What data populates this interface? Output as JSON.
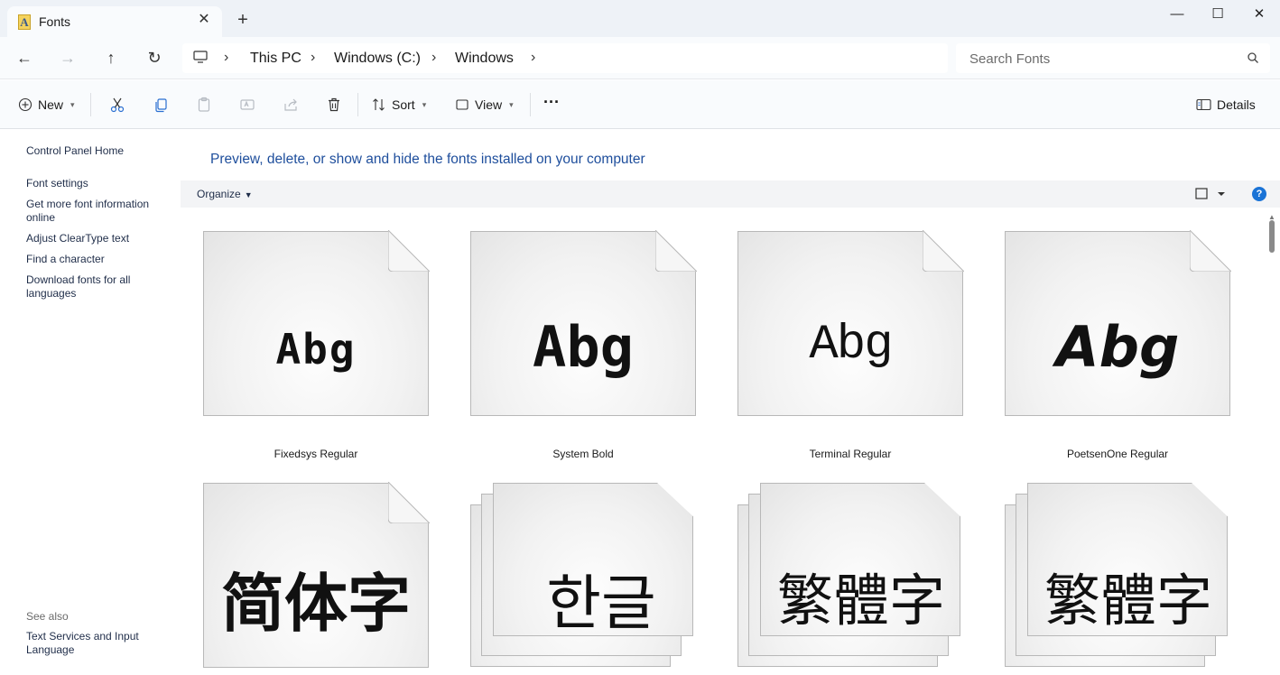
{
  "window": {
    "tab_title": "Fonts",
    "tab_close": "✕",
    "new_tab": "+",
    "minimize": "—",
    "maximize": "☐",
    "close": "✕"
  },
  "nav": {
    "back": "←",
    "forward": "→",
    "up": "↑",
    "refresh": "↻",
    "breadcrumbs": [
      "This PC",
      "Windows (C:)",
      "Windows"
    ],
    "search_placeholder": "Search Fonts"
  },
  "commandbar": {
    "new_label": "New",
    "sort_label": "Sort",
    "view_label": "View",
    "more_label": "···",
    "details_label": "Details"
  },
  "leftpane": {
    "links": [
      "Control Panel Home",
      "Font settings",
      "Get more font information online",
      "Adjust ClearType text",
      "Find a character",
      "Download fonts for all languages"
    ],
    "see_also_label": "See also",
    "see_also_links": [
      "Text Services and Input Language"
    ]
  },
  "main": {
    "heading": "Preview, delete, or show and hide the fonts installed on your computer",
    "organize_label": "Organize",
    "help_label": "?"
  },
  "fonts": [
    {
      "name": "Fixedsys Regular",
      "sample": "Abg",
      "stacked": false
    },
    {
      "name": "System Bold",
      "sample": "Abg",
      "stacked": false
    },
    {
      "name": "Terminal Regular",
      "sample": "Abg",
      "stacked": false
    },
    {
      "name": "PoetsenOne Regular",
      "sample": "Abg",
      "stacked": false
    },
    {
      "name": "",
      "sample": "简体字",
      "stacked": false
    },
    {
      "name": "",
      "sample": "한글",
      "stacked": true
    },
    {
      "name": "",
      "sample": "繁體字",
      "stacked": true
    },
    {
      "name": "",
      "sample": "繁體字",
      "stacked": true
    }
  ]
}
